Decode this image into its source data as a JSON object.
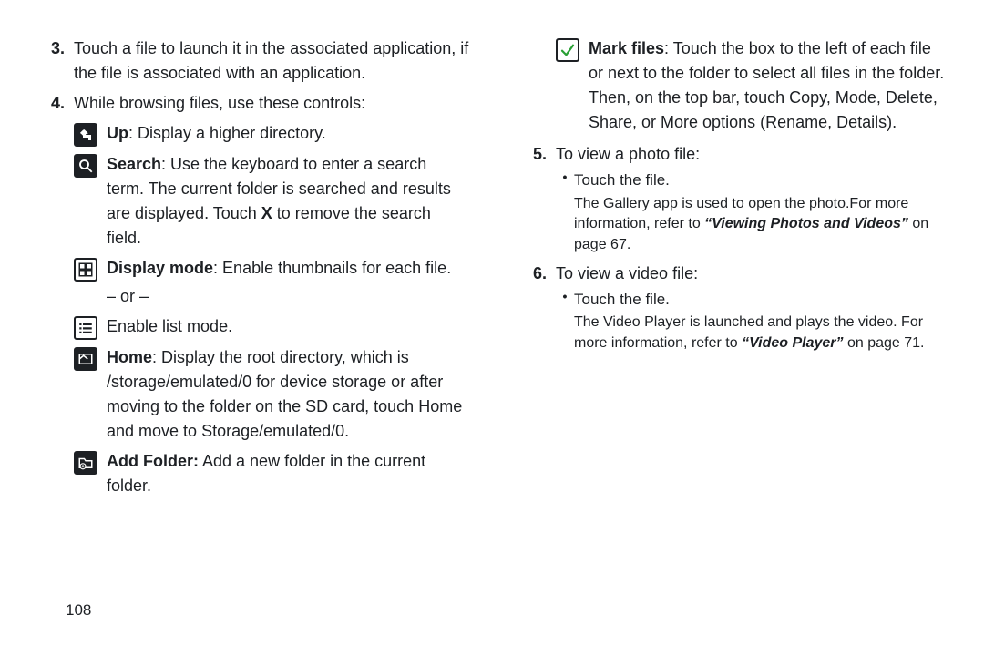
{
  "page_number": "108",
  "left": {
    "item3": {
      "num": "3.",
      "text": "Touch a file to launch it in the associated application, if the file is associated with an application."
    },
    "item4": {
      "num": "4.",
      "lead": "While browsing files, use these controls:",
      "up": {
        "bold": "Up",
        "rest": ": Display a higher directory."
      },
      "search": {
        "bold": "Search",
        "rest": ": Use the keyboard to enter a search term. The current folder is searched and results are displayed. Touch ",
        "boldX": "X",
        "rest2": " to remove the search field."
      },
      "display": {
        "bold": "Display mode",
        "rest": ": Enable thumbnails for each file."
      },
      "or": "– or –",
      "list": "Enable list mode.",
      "home": {
        "bold": "Home",
        "rest": ": Display the root directory, which is /storage/emulated/0 for device storage or after moving to the folder on the SD card, touch Home and move to Storage/emulated/0."
      },
      "addfolder": {
        "bold": "Add Folder:",
        "rest": " Add a new folder in the current folder."
      }
    }
  },
  "right": {
    "mark": {
      "bold": "Mark files",
      "rest": ": Touch the box to the left of each file or next to the folder to select all files in the folder. Then, on the top bar, touch Copy, Mode, Delete, Share, or More options (Rename, Details)."
    },
    "item5": {
      "num": "5.",
      "lead": "To view a photo file:",
      "bullet": "Touch the file.",
      "sub1": "The Gallery app is used to open the photo.For more information, refer to ",
      "subital": "“Viewing Photos and Videos”",
      "sub2": "  on page 67."
    },
    "item6": {
      "num": "6.",
      "lead": "To view a video file:",
      "bullet": "Touch the file.",
      "sub1": "The Video Player is launched and plays the video. For more information, refer to ",
      "subital": "“Video Player”",
      "sub2": "  on page 71."
    }
  }
}
